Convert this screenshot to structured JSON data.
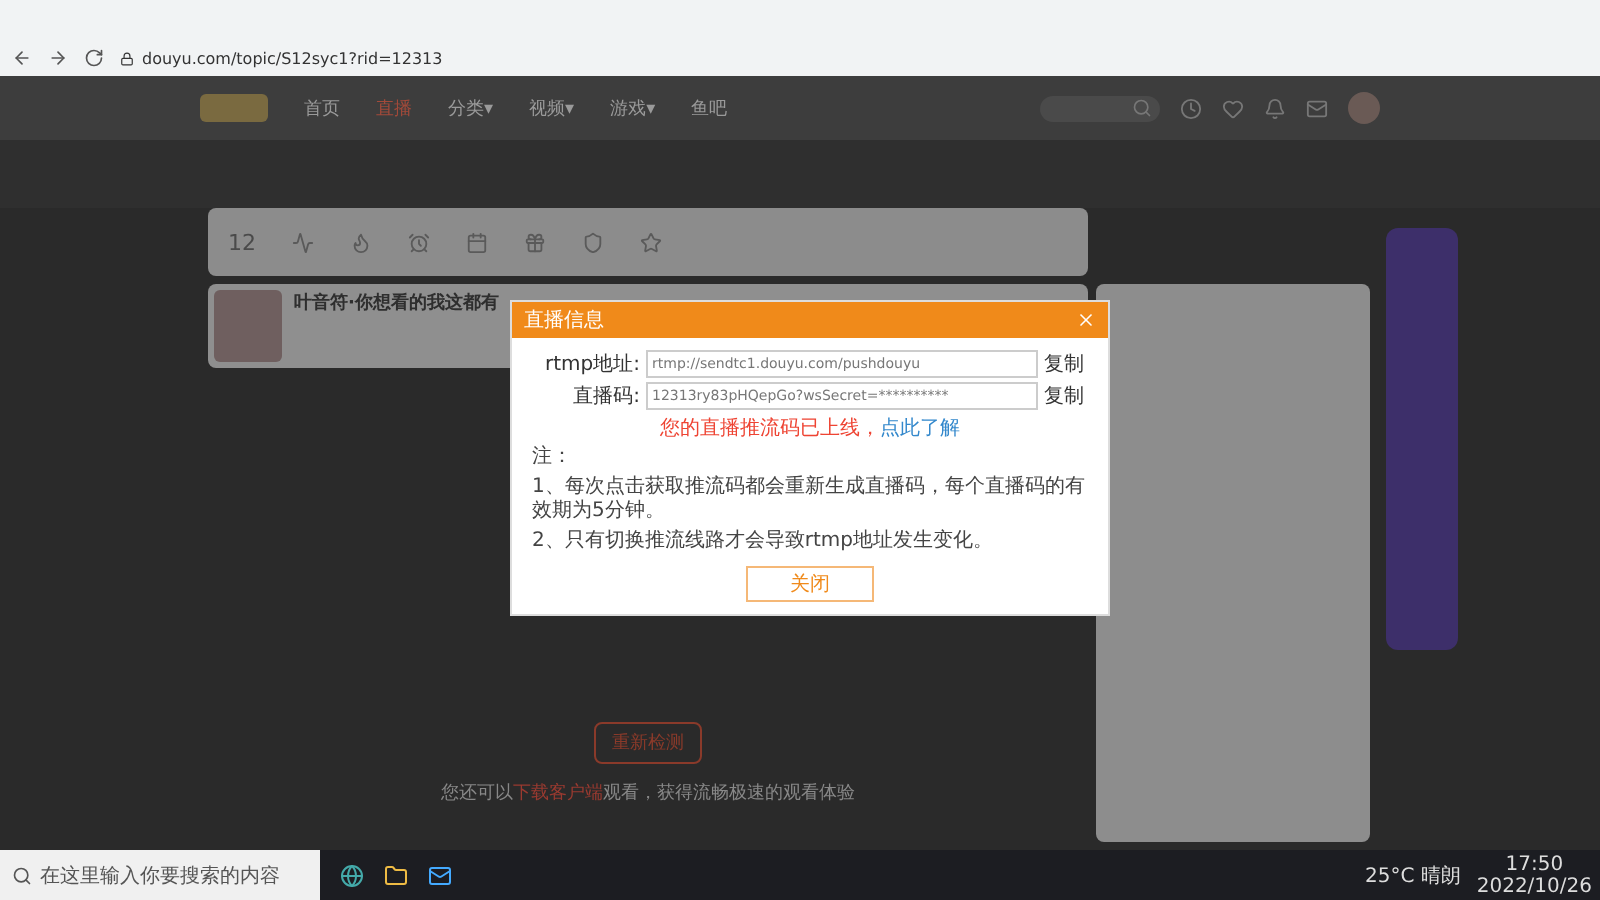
{
  "browser": {
    "url": "douyu.com/topic/S12syc1?rid=12313"
  },
  "nav": {
    "items": [
      {
        "label": "首页",
        "selected": false
      },
      {
        "label": "直播",
        "selected": true
      },
      {
        "label": "分类▾",
        "selected": false
      },
      {
        "label": "视频▾",
        "selected": false
      },
      {
        "label": "游戏▾",
        "selected": false
      },
      {
        "label": "鱼吧",
        "selected": false
      }
    ]
  },
  "toolbar": {
    "level": "12"
  },
  "streamer": {
    "title": "叶音符·你想看的我这都有"
  },
  "modal": {
    "title": "直播信息",
    "fields": [
      {
        "label": "rtmp地址:",
        "value": "rtmp://sendtc1.douyu.com/pushdouyu",
        "action": "复制"
      },
      {
        "label": "直播码:",
        "value": "12313ry83pHQepGo?wsSecret=**********",
        "action": "复制"
      }
    ],
    "status": "您的直播推流码已上线，",
    "status_link": "点此了解",
    "notes": [
      "注：",
      "1、每次点击获取推流码都会重新生成直播码，每个直播码的有效期为5分钟。",
      "2、只有切换推流线路才会导致rtmp地址发生变化。"
    ],
    "button": "关闭"
  },
  "player": {
    "button": "重新检测",
    "text_before": "您还可以",
    "text_link": "下载客户端",
    "text_after": "观看，获得流畅极速的观看体验"
  },
  "taskbar": {
    "search_placeholder": "在这里输入你要搜索的内容",
    "weather": "25°C 晴朗",
    "time": "17:50",
    "date": "2022/10/26"
  }
}
